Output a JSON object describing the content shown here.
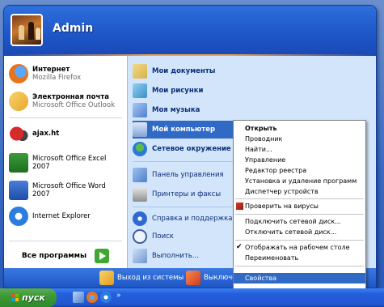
{
  "start_menu": {
    "username": "Admin",
    "pinned": [
      {
        "title": "Интернет",
        "subtitle": "Mozilla Firefox"
      },
      {
        "title": "Электронная почта",
        "subtitle": "Microsoft Office Outlook"
      }
    ],
    "recent": [
      {
        "label": "ajax.ht"
      },
      {
        "label": "Microsoft Office Excel 2007"
      },
      {
        "label": "Microsoft Office Word 2007"
      },
      {
        "label": "Internet Explorer"
      }
    ],
    "all_programs": "Все программы",
    "right": [
      {
        "label": "Мои документы"
      },
      {
        "label": "Мои рисунки"
      },
      {
        "label": "Моя музыка"
      },
      {
        "label": "Мой компьютер"
      },
      {
        "label": "Сетевое окружение"
      },
      {
        "label": "Панель управления"
      },
      {
        "label": "Принтеры и факсы"
      },
      {
        "label": "Справка и поддержка"
      },
      {
        "label": "Поиск"
      },
      {
        "label": "Выполнить..."
      }
    ],
    "footer": {
      "logoff": "Выход из системы",
      "shutdown": "Выключе"
    }
  },
  "context_menu": {
    "items": [
      "Открыть",
      "Проводник",
      "Найти...",
      "Управление",
      "Редактор реестра",
      "Установка и удаление программ",
      "Диспетчер устройств",
      "Проверить на вирусы",
      "Подключить сетевой диск...",
      "Отключить сетевой диск...",
      "Отображать на рабочем столе",
      "Переименовать",
      "Свойства"
    ]
  },
  "taskbar": {
    "start_label": "пуск",
    "chevron": "»"
  },
  "colors": {
    "accent": "#316ac5",
    "start_green": "#3c9a35",
    "taskbar_blue": "#245edb"
  }
}
